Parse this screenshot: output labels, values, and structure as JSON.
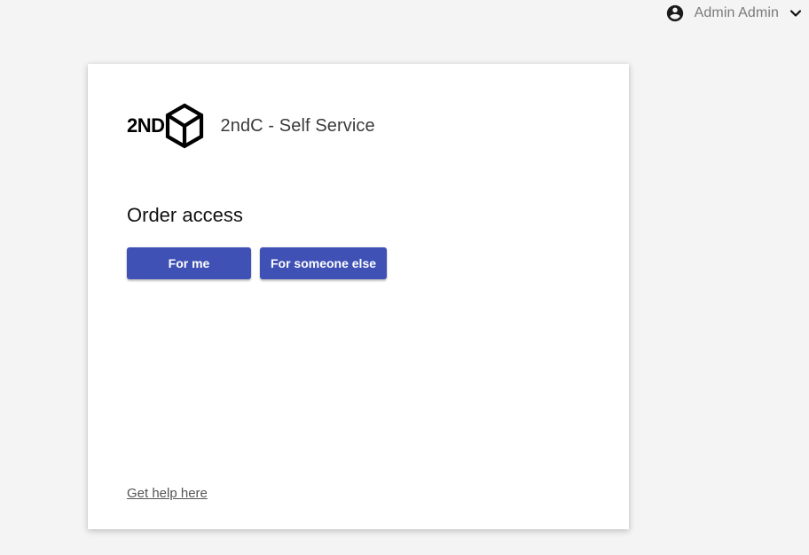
{
  "header": {
    "user_name": "Admin Admin",
    "avatar_icon": "account-circle-icon",
    "menu_icon": "chevron-down-icon"
  },
  "brand": {
    "logo_text": "2ND",
    "logo_icon": "cube-outline-icon",
    "app_name": "2ndC - Self Service"
  },
  "main": {
    "title": "Order access",
    "buttons": {
      "for_me": "For me",
      "for_someone_else": "For someone else"
    },
    "help_link": "Get help here"
  },
  "colors": {
    "primary": "#3f51b5",
    "background": "#f4f4f4",
    "card": "#ffffff"
  }
}
